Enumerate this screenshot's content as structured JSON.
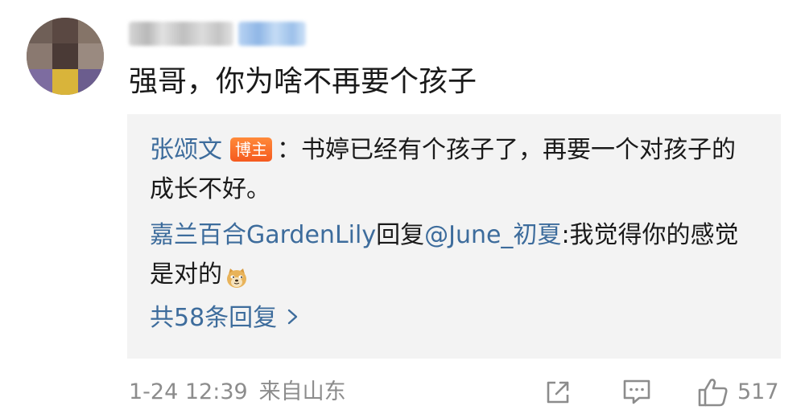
{
  "comment": {
    "text": "强哥，你为啥不再要个孩子"
  },
  "replies": [
    {
      "username": "张颂文",
      "badge": "博主",
      "text": "：书婷已经有个孩子了，再要一个对孩子的成长不好。"
    },
    {
      "username": "嘉兰百合GardenLily",
      "reply_word": "回复",
      "mention": "@June_初夏",
      "text": ":我觉得你的感觉是对的",
      "emoji": "doge-emoji"
    }
  ],
  "more_replies_label": "共58条回复",
  "footer": {
    "timestamp": "1-24 12:39",
    "location": "来自山东",
    "like_count": "517"
  },
  "colors": {
    "link": "#3d6c9c",
    "badge": "#f55a1f",
    "reply_bg": "#f3f3f3",
    "meta": "#8c8c8c"
  },
  "icons": {
    "share": "share-icon",
    "comment": "comment-icon",
    "like": "thumbs-up-icon",
    "chevron": "chevron-right-icon"
  }
}
